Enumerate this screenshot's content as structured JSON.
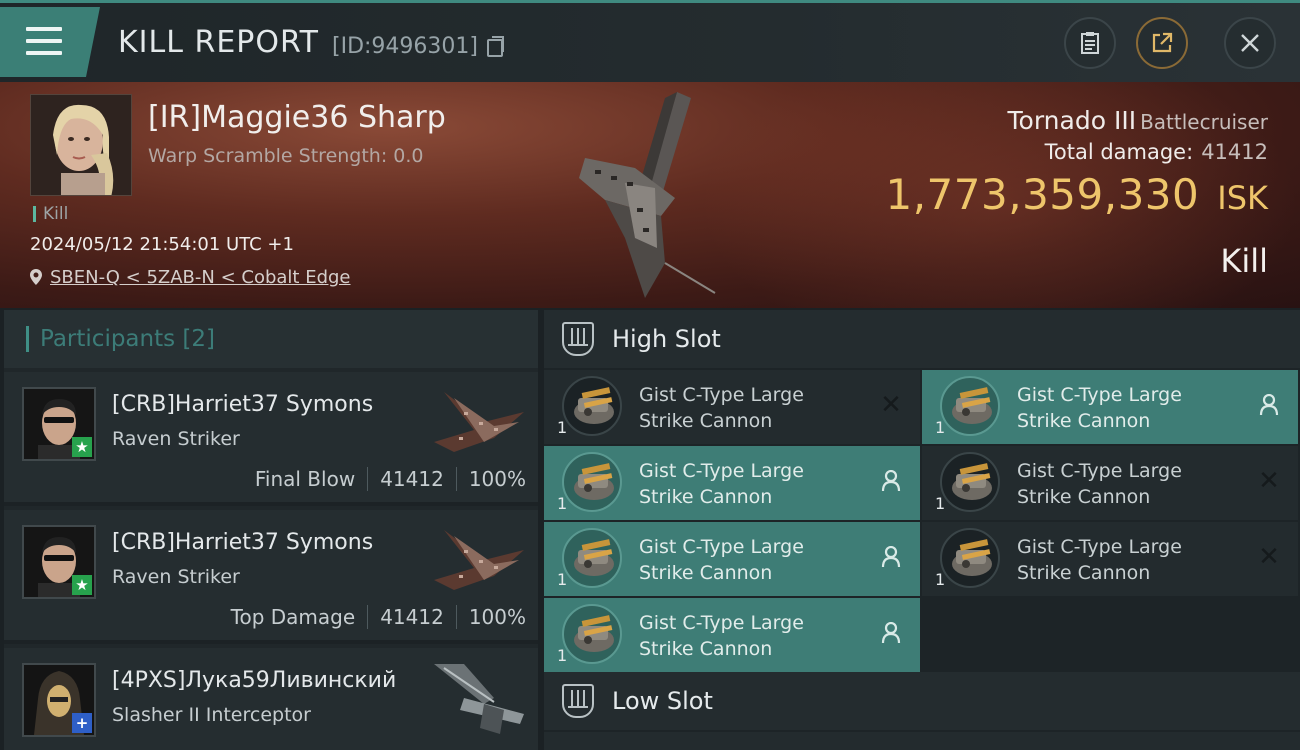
{
  "header": {
    "title": "KILL REPORT",
    "report_id": "[ID:9496301]",
    "icons": [
      "menu-icon",
      "copy-icon",
      "clipboard-icon",
      "share-icon",
      "close-icon"
    ]
  },
  "victim": {
    "name": "[IR]Maggie36 Sharp",
    "warp_scramble": "Warp Scramble Strength: 0.0",
    "kill_tag": "Kill",
    "datetime": "2024/05/12 21:54:01 UTC +1",
    "location": "SBEN-Q < 5ZAB-N < Cobalt Edge",
    "ship_name": "Tornado III",
    "ship_class": "Battlecruiser",
    "total_damage_label": "Total damage:",
    "total_damage_value": "41412",
    "isk_value": "1,773,359,330",
    "isk_unit": "ISK",
    "result": "Kill"
  },
  "participants": {
    "title": "Participants [2]",
    "rows": [
      {
        "name": "[CRB]Harriet37 Symons",
        "ship": "Raven Striker",
        "role": "Final Blow",
        "damage": "41412",
        "percent": "100%",
        "badge": "★",
        "badge_color": "green"
      },
      {
        "name": "[CRB]Harriet37 Symons",
        "ship": "Raven Striker",
        "role": "Top Damage",
        "damage": "41412",
        "percent": "100%",
        "badge": "★",
        "badge_color": "green"
      },
      {
        "name": "[4PXS]Лука59Ливинский",
        "ship": "Slasher II Interceptor",
        "role": "",
        "damage": "",
        "percent": "",
        "badge": "+",
        "badge_color": "blue"
      }
    ]
  },
  "slots": {
    "high_title": "High Slot",
    "low_title": "Low Slot",
    "high_modules": [
      {
        "qty": "1",
        "line1": "Gist C-Type Large",
        "line2": "Strike Cannon",
        "state": "destroyed",
        "highlight": false
      },
      {
        "qty": "1",
        "line1": "Gist C-Type Large",
        "line2": "Strike Cannon",
        "state": "dropped",
        "highlight": true
      },
      {
        "qty": "1",
        "line1": "Gist C-Type Large",
        "line2": "Strike Cannon",
        "state": "dropped",
        "highlight": true
      },
      {
        "qty": "1",
        "line1": "Gist C-Type Large",
        "line2": "Strike Cannon",
        "state": "destroyed",
        "highlight": false
      },
      {
        "qty": "1",
        "line1": "Gist C-Type Large",
        "line2": "Strike Cannon",
        "state": "dropped",
        "highlight": true
      },
      {
        "qty": "1",
        "line1": "Gist C-Type Large",
        "line2": "Strike Cannon",
        "state": "destroyed",
        "highlight": false
      },
      {
        "qty": "1",
        "line1": "Gist C-Type Large",
        "line2": "Strike Cannon",
        "state": "dropped",
        "highlight": true
      }
    ]
  },
  "colors": {
    "accent_teal": "#3e7d76",
    "isk_gold": "#eec56b",
    "banner_red": "#5f2b20"
  }
}
